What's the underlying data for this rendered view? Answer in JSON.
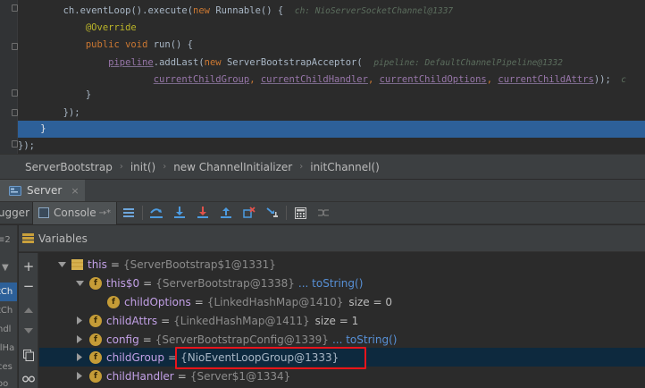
{
  "editor": {
    "lines": [
      {
        "indent": "        ",
        "tokens": [
          {
            "t": "ch",
            "c": "t-plain"
          },
          {
            "t": ".",
            "c": "t-plain"
          },
          {
            "t": "eventLoop",
            "c": "t-plain"
          },
          {
            "t": "().",
            "c": "t-plain"
          },
          {
            "t": "execute",
            "c": "t-plain"
          },
          {
            "t": "(",
            "c": "t-plain"
          },
          {
            "t": "new ",
            "c": "t-kw"
          },
          {
            "t": "Runnable",
            "c": "t-plain"
          },
          {
            "t": "() {  ",
            "c": "t-plain"
          },
          {
            "t": "ch: NioServerSocketChannel@1337",
            "c": "t-hint"
          }
        ]
      },
      {
        "indent": "            ",
        "tokens": [
          {
            "t": "@Override",
            "c": "t-ann"
          }
        ]
      },
      {
        "indent": "            ",
        "tokens": [
          {
            "t": "public void ",
            "c": "t-kw"
          },
          {
            "t": "run",
            "c": "t-plain"
          },
          {
            "t": "() {",
            "c": "t-plain"
          }
        ]
      },
      {
        "indent": "                ",
        "tokens": [
          {
            "t": "pipeline",
            "c": "t-field-u"
          },
          {
            "t": ".",
            "c": "t-plain"
          },
          {
            "t": "addLast",
            "c": "t-plain"
          },
          {
            "t": "(",
            "c": "t-plain"
          },
          {
            "t": "new ",
            "c": "t-kw"
          },
          {
            "t": "ServerBootstrapAcceptor",
            "c": "t-plain"
          },
          {
            "t": "(  ",
            "c": "t-plain"
          },
          {
            "t": "pipeline: DefaultChannelPipeline@1332",
            "c": "t-hint"
          }
        ]
      },
      {
        "indent": "                        ",
        "tokens": [
          {
            "t": "currentChildGroup",
            "c": "t-field-u"
          },
          {
            "t": ", ",
            "c": "t-kw"
          },
          {
            "t": "currentChildHandler",
            "c": "t-field-u"
          },
          {
            "t": ", ",
            "c": "t-kw"
          },
          {
            "t": "currentChildOptions",
            "c": "t-field-u"
          },
          {
            "t": ", ",
            "c": "t-kw"
          },
          {
            "t": "currentChildAttrs",
            "c": "t-field-u"
          },
          {
            "t": "));",
            "c": "t-plain"
          },
          {
            "t": "  c",
            "c": "t-hint"
          }
        ]
      },
      {
        "indent": "            ",
        "tokens": [
          {
            "t": "}",
            "c": "t-plain"
          }
        ]
      },
      {
        "indent": "        ",
        "tokens": [
          {
            "t": "});",
            "c": "t-plain"
          }
        ]
      },
      {
        "indent": "    ",
        "tokens": [
          {
            "t": "}",
            "c": "t-plain"
          }
        ],
        "current": true
      },
      {
        "indent": "",
        "tokens": [
          {
            "t": "});",
            "c": "t-plain"
          }
        ]
      }
    ]
  },
  "breadcrumb": [
    "ServerBootstrap",
    "init()",
    "new ChannelInitializer",
    "initChannel()"
  ],
  "debug_tab": {
    "label": "Server",
    "close": "×"
  },
  "toolbar": {
    "debugger_label": "ugger",
    "console_label": "Console",
    "console_arrow": "→*"
  },
  "left_strip": {
    "items": [
      "2",
      "tCh",
      "tCh",
      "ndl",
      "llHa",
      "ces",
      "oo"
    ]
  },
  "variables": {
    "title": "Variables",
    "rows": [
      {
        "depth": 0,
        "expanded": true,
        "icon": "obj",
        "name": "this",
        "value": "{ServerBootstrap$1@1331}",
        "link": "",
        "extra": ""
      },
      {
        "depth": 1,
        "expanded": true,
        "icon": "field",
        "name": "this$0",
        "value": "{ServerBootstrap@1338}",
        "link": "... toString()",
        "extra": ""
      },
      {
        "depth": 2,
        "expanded": null,
        "icon": "field",
        "name": "childOptions",
        "value": "{LinkedHashMap@1410}",
        "link": "",
        "extra": "size = 0"
      },
      {
        "depth": 2,
        "expanded": false,
        "icon": "field",
        "name": "childAttrs",
        "value": "{LinkedHashMap@1411}",
        "link": "",
        "extra": "size = 1"
      },
      {
        "depth": 2,
        "expanded": false,
        "icon": "field",
        "name": "config",
        "value": "{ServerBootstrapConfig@1339}",
        "link": "... toString()",
        "extra": ""
      },
      {
        "depth": 2,
        "expanded": false,
        "icon": "field",
        "name": "childGroup",
        "value": "{NioEventLoopGroup@1333}",
        "link": "",
        "extra": "",
        "selected": true
      },
      {
        "depth": 2,
        "expanded": false,
        "icon": "field",
        "name": "childHandler",
        "value": "{Server$1@1334}",
        "link": "",
        "extra": ""
      }
    ]
  },
  "colors": {
    "accent": "#2d6099",
    "highlight_box": "#e8141c"
  }
}
